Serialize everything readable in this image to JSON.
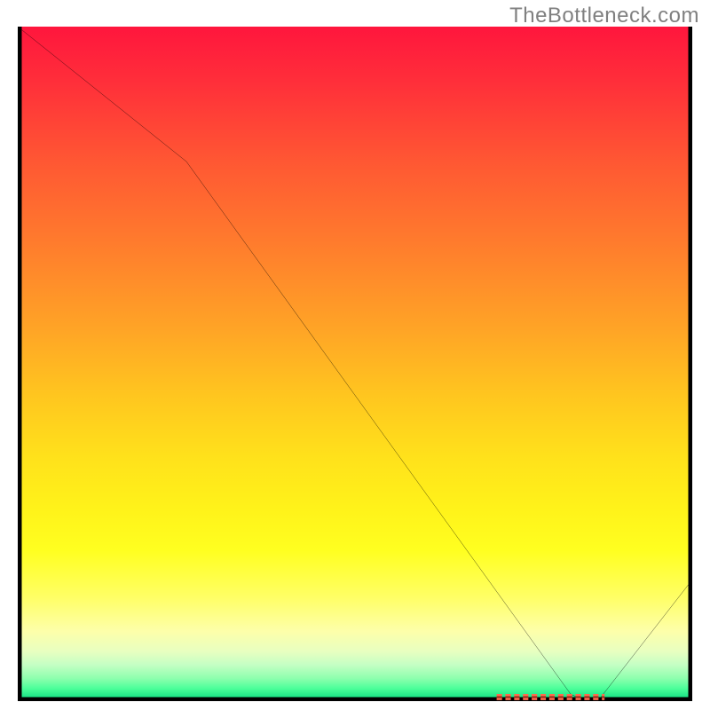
{
  "watermark": "TheBottleneck.com",
  "colors": {
    "axis": "#000000",
    "curve": "#000000",
    "marker_fill": "#ff6a4d",
    "marker_stroke": "#8a2a1a",
    "watermark": "#808080"
  },
  "chart_data": {
    "type": "line",
    "title": "",
    "xlabel": "",
    "ylabel": "",
    "x": [
      0,
      25,
      82,
      84,
      86,
      100
    ],
    "values": [
      100,
      80,
      1,
      0,
      0,
      18
    ],
    "xlim": [
      0,
      100
    ],
    "ylim": [
      0,
      100
    ],
    "marker_range_x": [
      71,
      87
    ],
    "marker_y": 0,
    "background": "vertical red→yellow→green gradient"
  }
}
